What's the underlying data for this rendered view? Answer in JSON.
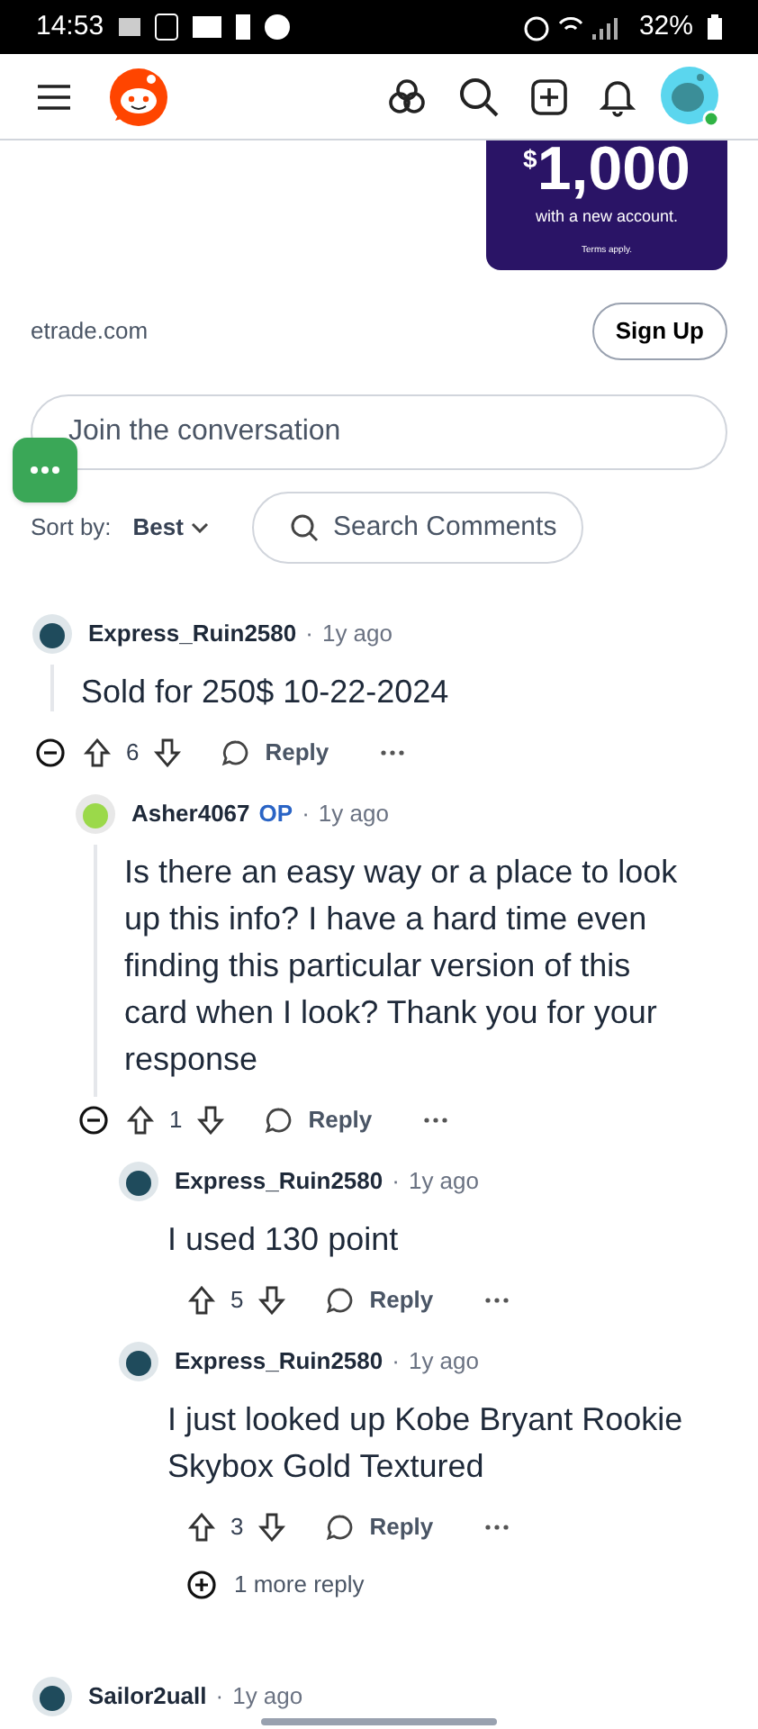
{
  "status_bar": {
    "time": "14:53",
    "battery": "32%"
  },
  "ad": {
    "currency": "$",
    "amount": "1,000",
    "subtitle": "with a new account.",
    "terms": "Terms apply.",
    "domain": "etrade.com",
    "cta": "Sign Up"
  },
  "composer": {
    "placeholder": "Join the conversation"
  },
  "sort": {
    "label": "Sort by:",
    "value": "Best"
  },
  "search": {
    "placeholder": "Search Comments"
  },
  "comments": [
    {
      "user": "Express_Ruin2580",
      "separator": "·",
      "time": "1y ago",
      "body": "Sold for 250$ 10-22-2024",
      "votes": "6",
      "reply": "Reply",
      "expanded": true,
      "children": [
        {
          "user": "Asher4067",
          "op_label": "OP",
          "separator": "·",
          "time": "1y ago",
          "body": "Is there an easy way or a place to look up this info? I have a hard time even finding this particular version of this card when I look? Thank you for your response",
          "votes": "1",
          "reply": "Reply",
          "expanded": true,
          "more": "1 more reply",
          "children": [
            {
              "user": "Express_Ruin2580",
              "separator": "·",
              "time": "1y ago",
              "body": "I used 130 point",
              "votes": "5",
              "reply": "Reply",
              "expanded": false
            },
            {
              "user": "Express_Ruin2580",
              "separator": "·",
              "time": "1y ago",
              "body": "I just looked up Kobe Bryant Rookie Skybox Gold Textured",
              "votes": "3",
              "reply": "Reply",
              "expanded": false
            }
          ]
        }
      ]
    },
    {
      "user": "Sailor2uall",
      "separator": "·",
      "time": "1y ago"
    }
  ]
}
